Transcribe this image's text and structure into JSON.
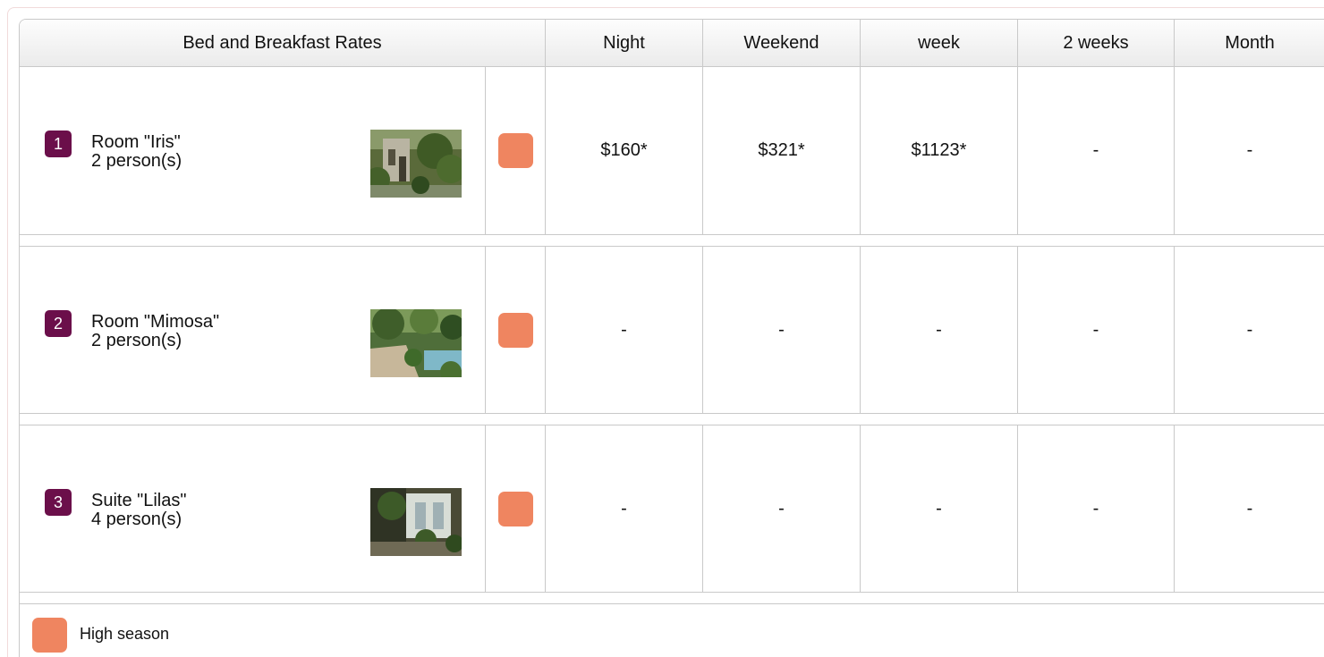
{
  "table": {
    "headers": [
      "Bed and Breakfast Rates",
      "Night",
      "Weekend",
      "week",
      "2 weeks",
      "Month"
    ],
    "rows": [
      {
        "number": "1",
        "name": "Room \"Iris\"",
        "capacity": "2 person(s)",
        "photo": "photo-iris",
        "prices": [
          "$160*",
          "$321*",
          "$1123*",
          "-",
          "-"
        ]
      },
      {
        "number": "2",
        "name": "Room \"Mimosa\"",
        "capacity": "2 person(s)",
        "photo": "photo-mimosa",
        "prices": [
          "-",
          "-",
          "-",
          "-",
          "-"
        ]
      },
      {
        "number": "3",
        "name": "Suite \"Lilas\"",
        "capacity": "4 person(s)",
        "photo": "photo-lilas",
        "prices": [
          "-",
          "-",
          "-",
          "-",
          "-"
        ]
      }
    ]
  },
  "legend": {
    "label": "High season",
    "color": "#ef8560"
  },
  "colors": {
    "badge": "#6b0f4a",
    "season": "#ef8560",
    "border": "#c9c9c9"
  }
}
